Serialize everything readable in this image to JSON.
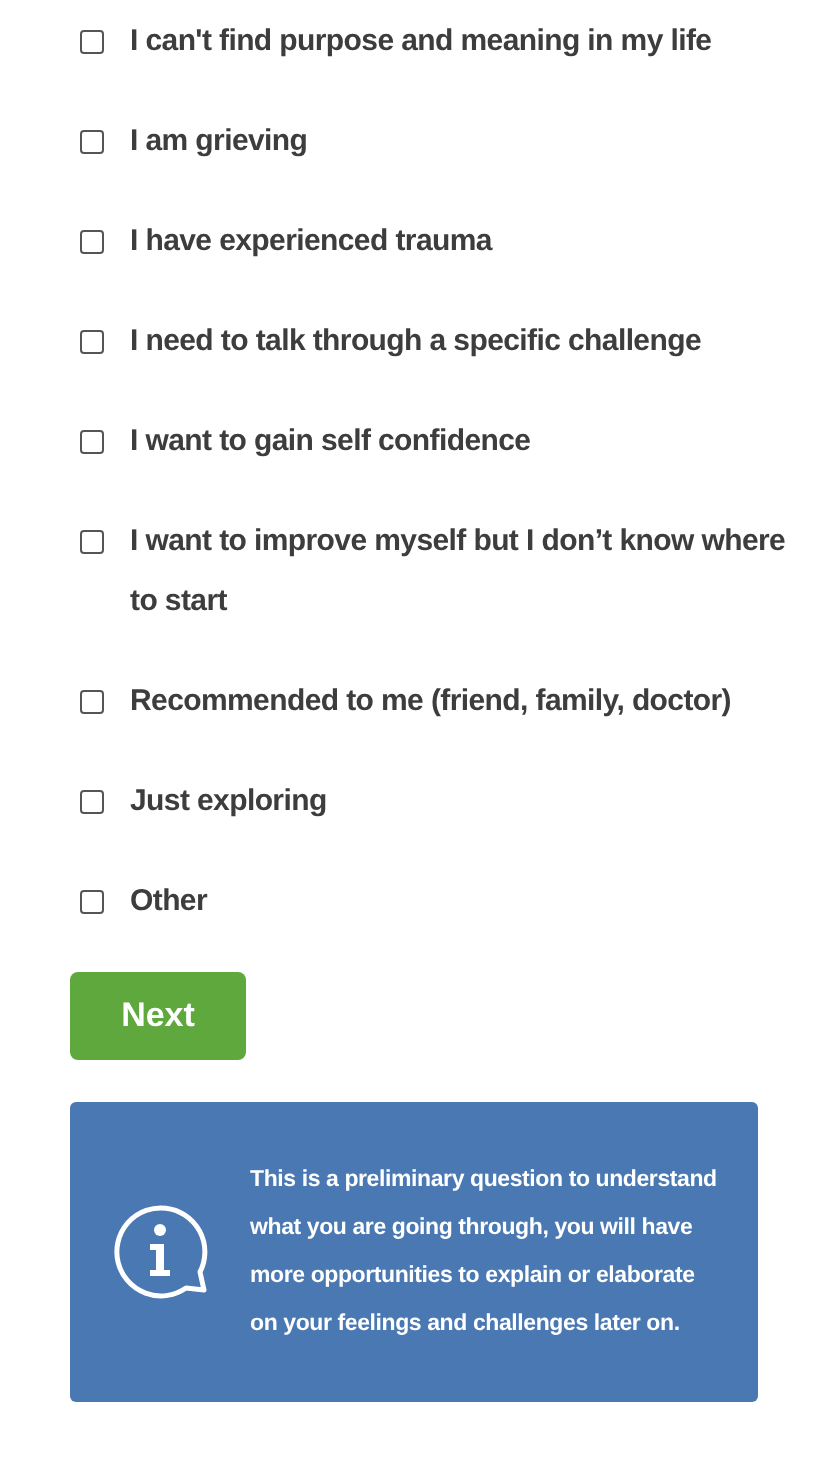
{
  "options": [
    {
      "label": "I can't find purpose and meaning in my life",
      "checked": false
    },
    {
      "label": "I am grieving",
      "checked": false
    },
    {
      "label": "I have experienced trauma",
      "checked": false
    },
    {
      "label": "I need to talk through a specific challenge",
      "checked": false
    },
    {
      "label": "I want to gain self confidence",
      "checked": false
    },
    {
      "label": "I want to improve myself but I don’t know where to start",
      "checked": false
    },
    {
      "label": "Recommended to me (friend, family, doctor)",
      "checked": false
    },
    {
      "label": "Just exploring",
      "checked": false
    },
    {
      "label": "Other",
      "checked": false
    }
  ],
  "next_button": "Next",
  "info_box": {
    "text": "This is a preliminary question to understand what you are going through, you will have more opportunities to explain or elaborate on your feelings and challenges later on."
  }
}
